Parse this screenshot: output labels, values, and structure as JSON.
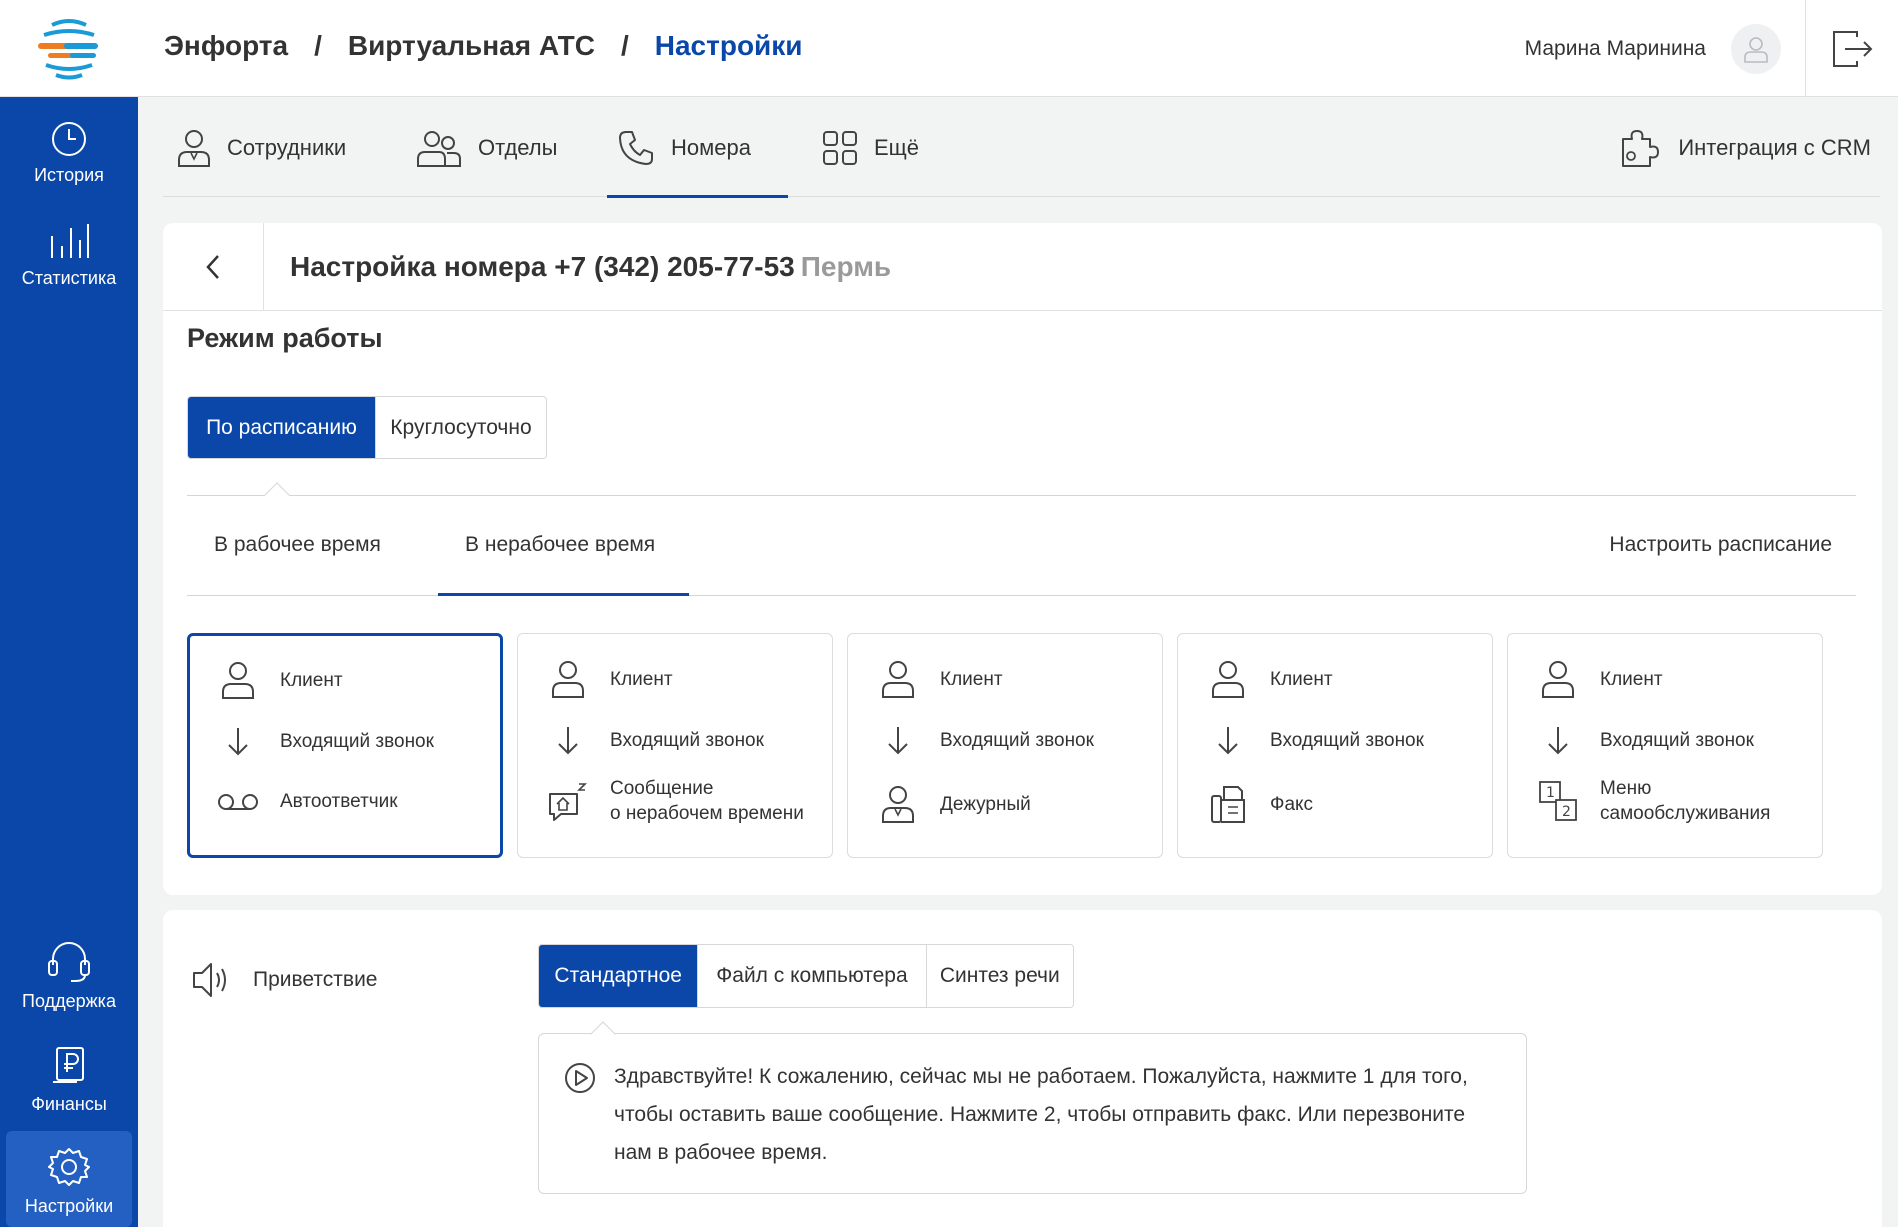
{
  "sidebar": {
    "items": [
      {
        "label": "История",
        "icon": "clock-icon"
      },
      {
        "label": "Статистика",
        "icon": "bars-icon"
      },
      {
        "label": "Поддержка",
        "icon": "headset-icon"
      },
      {
        "label": "Финансы",
        "icon": "ruble-doc-icon"
      },
      {
        "label": "Настройки",
        "icon": "gear-icon",
        "active": true
      }
    ]
  },
  "header": {
    "breadcrumb": [
      "Энфорта",
      "Виртуальная АТС",
      "Настройки"
    ],
    "separator": "/",
    "user_name": "Марина Маринина"
  },
  "nav": {
    "tabs": [
      {
        "label": "Сотрудники",
        "icon": "person-icon"
      },
      {
        "label": "Отделы",
        "icon": "group-icon"
      },
      {
        "label": "Номера",
        "icon": "phone-icon",
        "active": true
      },
      {
        "label": "Ещё",
        "icon": "grid-icon"
      }
    ],
    "crm_label": "Интеграция с CRM"
  },
  "number_settings": {
    "title": "Настройка номера +7 (342) 205-77-53",
    "city": "Пермь",
    "mode_title": "Режим работы",
    "mode_options": [
      "По расписанию",
      "Круглосуточно"
    ],
    "mode_selected": "По расписанию",
    "time_tabs": [
      "В рабочее время",
      "В нерабочее время"
    ],
    "time_tab_selected": "В нерабочее время",
    "configure_schedule": "Настроить расписание",
    "scenarios": [
      {
        "client": "Клиент",
        "incoming": "Входящий звонок",
        "target": "Автоответчик",
        "target_icon": "voicemail-icon",
        "selected": true
      },
      {
        "client": "Клиент",
        "incoming": "Входящий звонок",
        "target": "Сообщение",
        "target2": "о нерабочем времени",
        "target_icon": "sleep-message-icon"
      },
      {
        "client": "Клиент",
        "incoming": "Входящий звонок",
        "target": "Дежурный",
        "target_icon": "duty-person-icon"
      },
      {
        "client": "Клиент",
        "incoming": "Входящий звонок",
        "target": "Факс",
        "target_icon": "fax-icon"
      },
      {
        "client": "Клиент",
        "incoming": "Входящий звонок",
        "target": "Меню",
        "target2": "самообслуживания",
        "target_icon": "menu-12-icon"
      }
    ]
  },
  "greeting": {
    "label": "Приветствие",
    "options": [
      "Стандартное",
      "Файл с компьютера",
      "Синтез речи"
    ],
    "selected": "Стандартное",
    "text": "Здравствуйте! К сожалению, сейчас мы не работаем. Пожалуйста, нажмите 1 для того, чтобы оставить ваше сообщение. Нажмите 2, чтобы отправить факс. Или перезвоните нам в рабочее время."
  },
  "colors": {
    "brand_blue": "#0a47a9",
    "sidebar_active": "#2460c2",
    "logo_orange": "#f07c22",
    "logo_blue": "#1a9ad6"
  }
}
